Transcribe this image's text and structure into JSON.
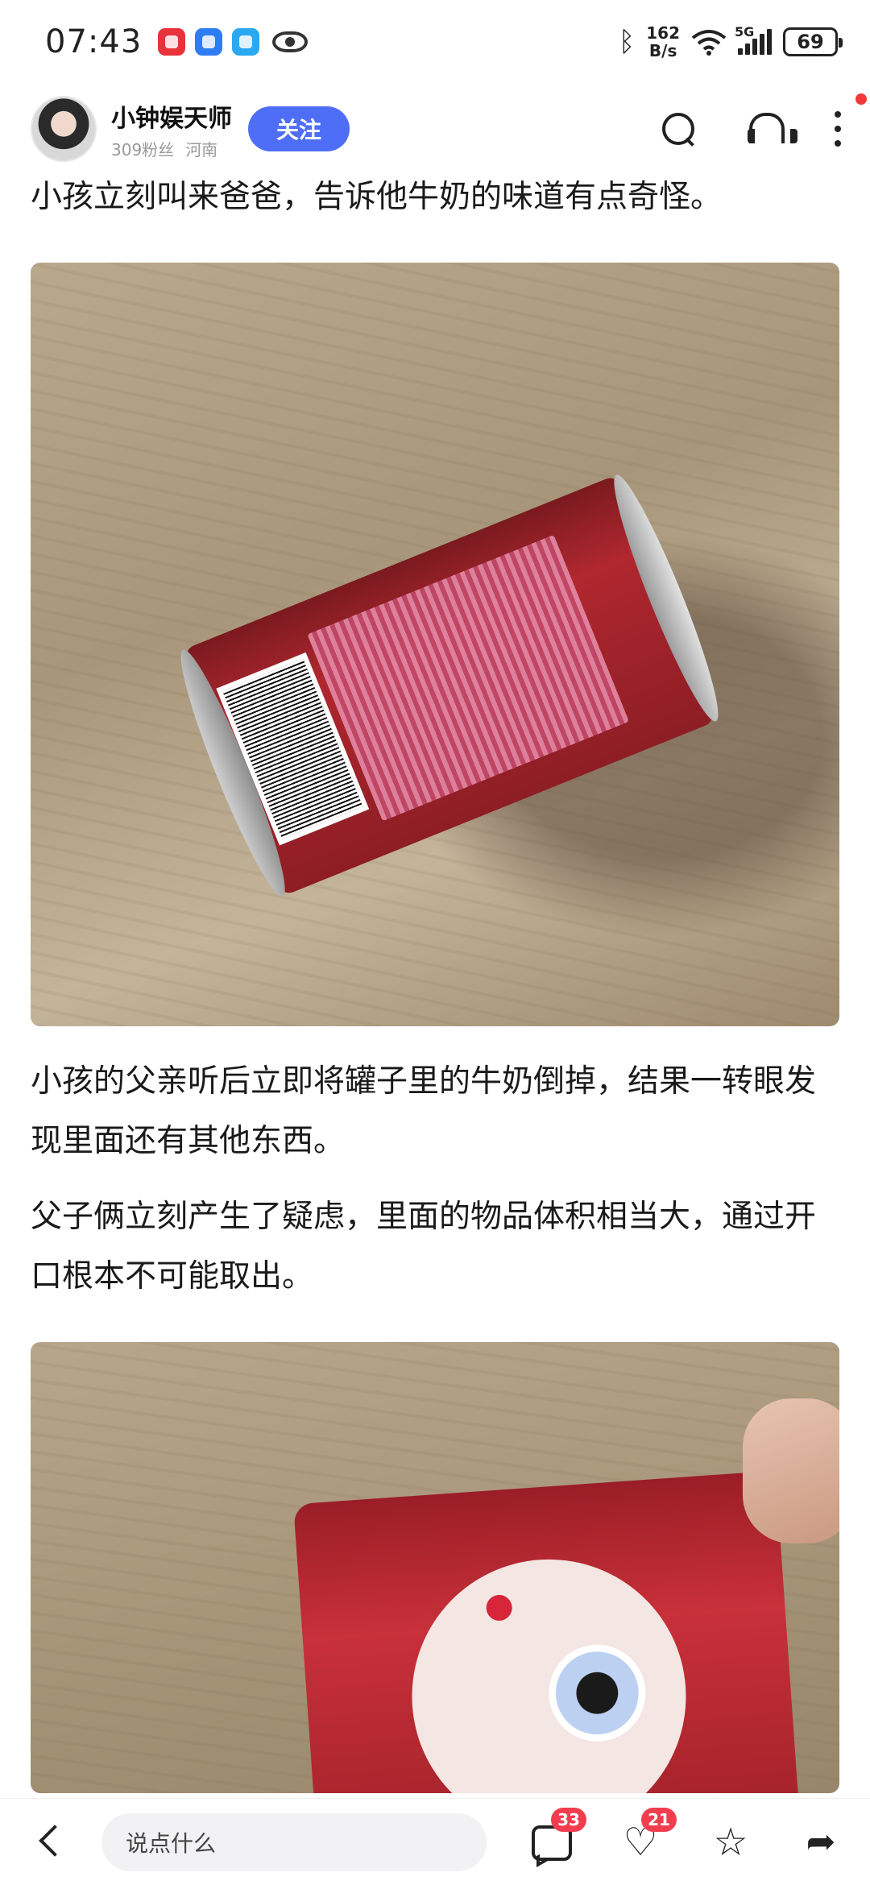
{
  "status_bar": {
    "time": "07:43",
    "net_speed_value": "162",
    "net_speed_unit": "B/s",
    "network_type": "5G",
    "battery": "69"
  },
  "author": {
    "name": "小钟娱天师",
    "followers": "309粉丝",
    "location": "河南",
    "follow_label": "关注"
  },
  "article": {
    "paragraph_1": "小孩立刻叫来爸爸，告诉他牛奶的味道有点奇怪。",
    "paragraph_2": "小孩的父亲听后立即将罐子里的牛奶倒掉，结果一转眼发现里面还有其他东西。",
    "paragraph_3": "父子俩立刻产生了疑虑，里面的物品体积相当大，通过开口根本不可能取出。"
  },
  "bottom_bar": {
    "comment_placeholder": "说点什么",
    "comment_count": "33",
    "like_count": "21"
  },
  "colors": {
    "follow_button": "#4f6ef7",
    "badge": "#f23d4f"
  },
  "icons": [
    "search-icon",
    "headset-icon",
    "more-icon",
    "back-icon",
    "comment-icon",
    "heart-icon",
    "star-icon",
    "share-icon"
  ]
}
